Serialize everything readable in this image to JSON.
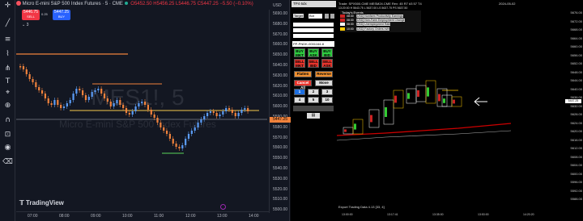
{
  "tv": {
    "symbol_title": "Micro E-mini S&P 500 Index Futures · 5 · CME",
    "ohlc": "O5452.50 H5456.25 L5446.75 C5447.25 −5.50 (−0.10%)",
    "sell_price": "5446.75",
    "sell_label": "SELL",
    "spread": "0.25",
    "buy_price": "5447.25",
    "buy_label": "BUY",
    "layers_count": "3",
    "watermark_symbol": "MES1!, 5",
    "watermark_name": "Micro E-mini S&P 500 Index Futures",
    "brand": "TradingView",
    "currency": "USD",
    "current_price": "5447.25",
    "price_labels": [
      "5690.00",
      "5680.00",
      "5670.00",
      "5660.00",
      "5650.00",
      "5640.00",
      "5630.00",
      "5620.00",
      "5610.00",
      "5600.00",
      "5590.00",
      "5580.00",
      "5570.00",
      "5560.00",
      "5550.00",
      "5540.00",
      "5530.00",
      "5520.00",
      "5510.00",
      "5500.00"
    ],
    "time_labels": [
      "07:00",
      "08:00",
      "09:00",
      "10:00",
      "11:00",
      "12:00",
      "13:00",
      "14:00"
    ],
    "toolbar_icons": [
      "crosshair-icon",
      "trend-line-icon",
      "horizontal-line-icon",
      "brush-icon",
      "fib-icon",
      "text-icon",
      "measure-icon",
      "zoom-icon",
      "magnet-icon",
      "lock-icon",
      "eye-icon",
      "trash-icon"
    ]
  },
  "order_panel": {
    "title": "TP4 6dx",
    "target_label": "Target",
    "target_value": "Bot",
    "account": "PP-PNDK-0001164-8",
    "buy_mkt": "BUY MKT",
    "buy_ask": "BUY ASK",
    "buy_bid": "BUY BID",
    "sell_mkt": "SELL MKT",
    "sell_bid": "SELL BID",
    "sell_ask": "SELL ASK",
    "flatten": "Flatten",
    "reverse": "Reverse",
    "cancel_all": "Cancel All",
    "move": "Move",
    "qty_buttons": [
      "1",
      "2",
      "3",
      "4",
      "5",
      "10"
    ]
  },
  "sierra": {
    "header": "Trade: SPX500.CME  MESM24.CME  Rev: 45  R7 #3  57  T4",
    "date": "2024-05-02",
    "quote": "13:20:00  H 5643.75  L 5637.00  LS 5637.75  PS 5637.50",
    "events_title": "Today's Events",
    "events": [
      {
        "time": "08:30",
        "text": "[USD] Nonfarm Productivity Earnings",
        "color": "#cc2222"
      },
      {
        "time": "08:30",
        "text": "[USD] Non-Farm Employment Change",
        "color": "#cc2222"
      },
      {
        "time": "08:30",
        "text": "[USD] Unemployment Rate",
        "color": "#ffffff"
      },
      {
        "time": "10:00",
        "text": "[USD] Factory Orders m/m",
        "color": "#ffcc00"
      }
    ],
    "footer": "Export Trading Data 4.13   [33, 4]",
    "times": [
      "13:00:00",
      "13:17:41",
      "13:35:00",
      "13:53:00",
      "14:20:20"
    ],
    "prices": [
      "5676.00",
      "5672.00",
      "5668.00",
      "5664.00",
      "5660.00",
      "5656.00",
      "5652.00",
      "5648.00",
      "5644.00",
      "5640.00",
      "5636.00",
      "5632.00",
      "5628.00",
      "5624.00",
      "5620.00",
      "5616.00",
      "5612.00",
      "5608.00",
      "5604.00",
      "5600.00",
      "5596.00",
      "5592.00",
      "5588.00"
    ],
    "arrow_label": "⟵"
  }
}
